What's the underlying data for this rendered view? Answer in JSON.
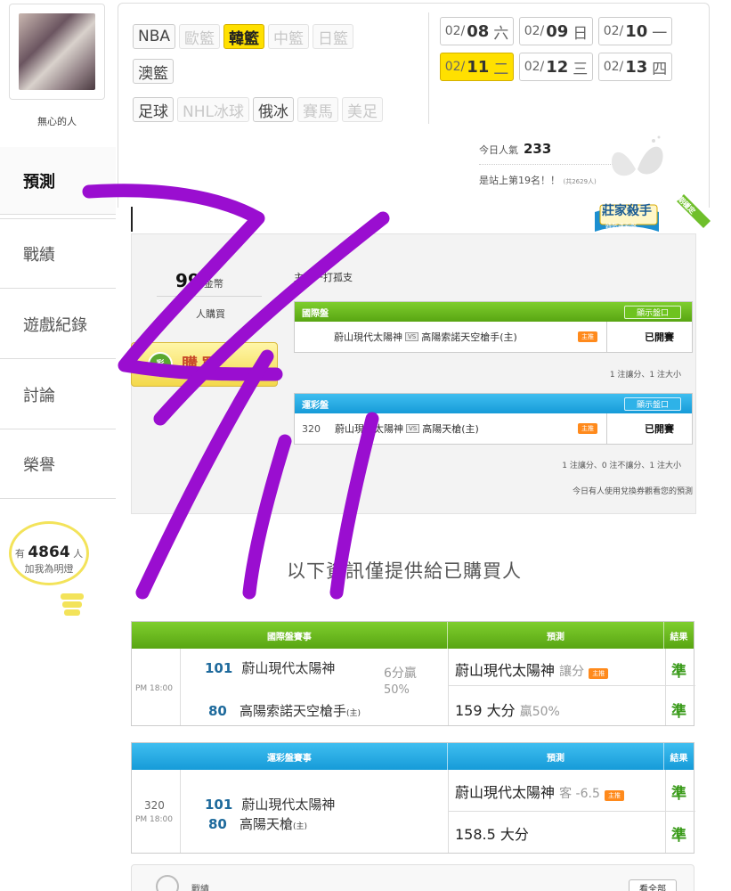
{
  "user": {
    "name": "無心的人"
  },
  "nav": [
    {
      "label": "預測",
      "active": true
    },
    {
      "label": "戰績"
    },
    {
      "label": "遊戲紀錄"
    },
    {
      "label": "討論"
    },
    {
      "label": "榮譽"
    }
  ],
  "fans": {
    "prefix": "有",
    "count": "4864",
    "suffix": "人",
    "label": "加我為明燈"
  },
  "leagues_row1": [
    {
      "label": "NBA",
      "state": "norm"
    },
    {
      "label": "歐籃",
      "state": "dim"
    },
    {
      "label": "韓籃",
      "state": "on"
    },
    {
      "label": "中籃",
      "state": "dim"
    },
    {
      "label": "日籃",
      "state": "dim"
    }
  ],
  "leagues_row2": [
    {
      "label": "澳籃",
      "state": "norm"
    }
  ],
  "leagues_row3": [
    {
      "label": "足球",
      "state": "norm"
    },
    {
      "label": "NHL冰球",
      "state": "dim"
    },
    {
      "label": "俄冰",
      "state": "norm"
    },
    {
      "label": "賽馬",
      "state": "dim"
    },
    {
      "label": "美足",
      "state": "dim"
    }
  ],
  "dates": [
    {
      "pre": "02/",
      "day": "08",
      "wd": "六",
      "on": false
    },
    {
      "pre": "02/",
      "day": "09",
      "wd": "日",
      "on": false
    },
    {
      "pre": "02/",
      "day": "10",
      "wd": "一",
      "on": false
    },
    {
      "pre": "02/",
      "day": "11",
      "wd": "二",
      "on": true
    },
    {
      "pre": "02/",
      "day": "12",
      "wd": "三",
      "on": false
    },
    {
      "pre": "02/",
      "day": "13",
      "wd": "四",
      "on": false
    }
  ],
  "popularity": {
    "label": "今日人氣",
    "value": "233",
    "rank_text": "是站上第19名！！",
    "rank_total": "(共2629人)"
  },
  "badge": {
    "title": "莊家殺手",
    "sub": "韓籃運彩盤",
    "ribbon": "長期穩定"
  },
  "predict": {
    "coins": "99",
    "coins_unit": "金幣",
    "bought": "人購買",
    "buy_label": "購買",
    "main_tip": "主推一打孤支",
    "intl": {
      "title": "國際盤",
      "show": "顯示盤口",
      "home": "蔚山現代太陽神",
      "vs": "VS",
      "away": "高陽索諾天空槍手(主)",
      "host": "主推",
      "status": "已開賽",
      "note": "1 注讓分、1 注大小"
    },
    "lottery": {
      "title": "運彩盤",
      "show": "顯示盤口",
      "code": "320",
      "home": "蔚山現代太陽神",
      "vs": "VS",
      "away": "高陽天槍(主)",
      "host": "主推",
      "status": "已開賽",
      "note": "1 注讓分、0 注不讓分、1 注大小"
    },
    "voucher_note": "今日有人使用兌換券觀看您的預測"
  },
  "info_line": "以下資訊僅提供給已購買人",
  "intl_table": {
    "h1": "國際盤賽事",
    "h2": "預測",
    "h3": "結果",
    "time": "PM 18:00",
    "t1_num": "101",
    "t1_name": "蔚山現代太陽神",
    "t2_num": "80",
    "t2_name": "高陽索諾天空槍手",
    "t2_host": "(主)",
    "line1": "6分贏",
    "line2": "50%",
    "p1": "蔚山現代太陽神",
    "p1_extra": "讓分",
    "p2": "159 大分",
    "p2_extra": "贏50%",
    "r1": "準",
    "r2": "準",
    "host": "主推"
  },
  "lot_table": {
    "h1": "運彩盤賽事",
    "h2": "預測",
    "h3": "結果",
    "code": "320",
    "time": "PM 18:00",
    "t1_num": "101",
    "t1_name": "蔚山現代太陽神",
    "t2_num": "80",
    "t2_name": "高陽天槍",
    "t2_host": "(主)",
    "p1": "蔚山現代太陽神",
    "p1_extra": "客 -6.5",
    "p2": "158.5 大分",
    "r1": "準",
    "r2": "準",
    "host": "主推"
  },
  "record": {
    "label": "戰績",
    "see_all": "看全部"
  },
  "colors": {
    "accent": "#ffe000",
    "green": "#58a512",
    "blue": "#169bd8",
    "scribble": "#9a0ed0"
  }
}
